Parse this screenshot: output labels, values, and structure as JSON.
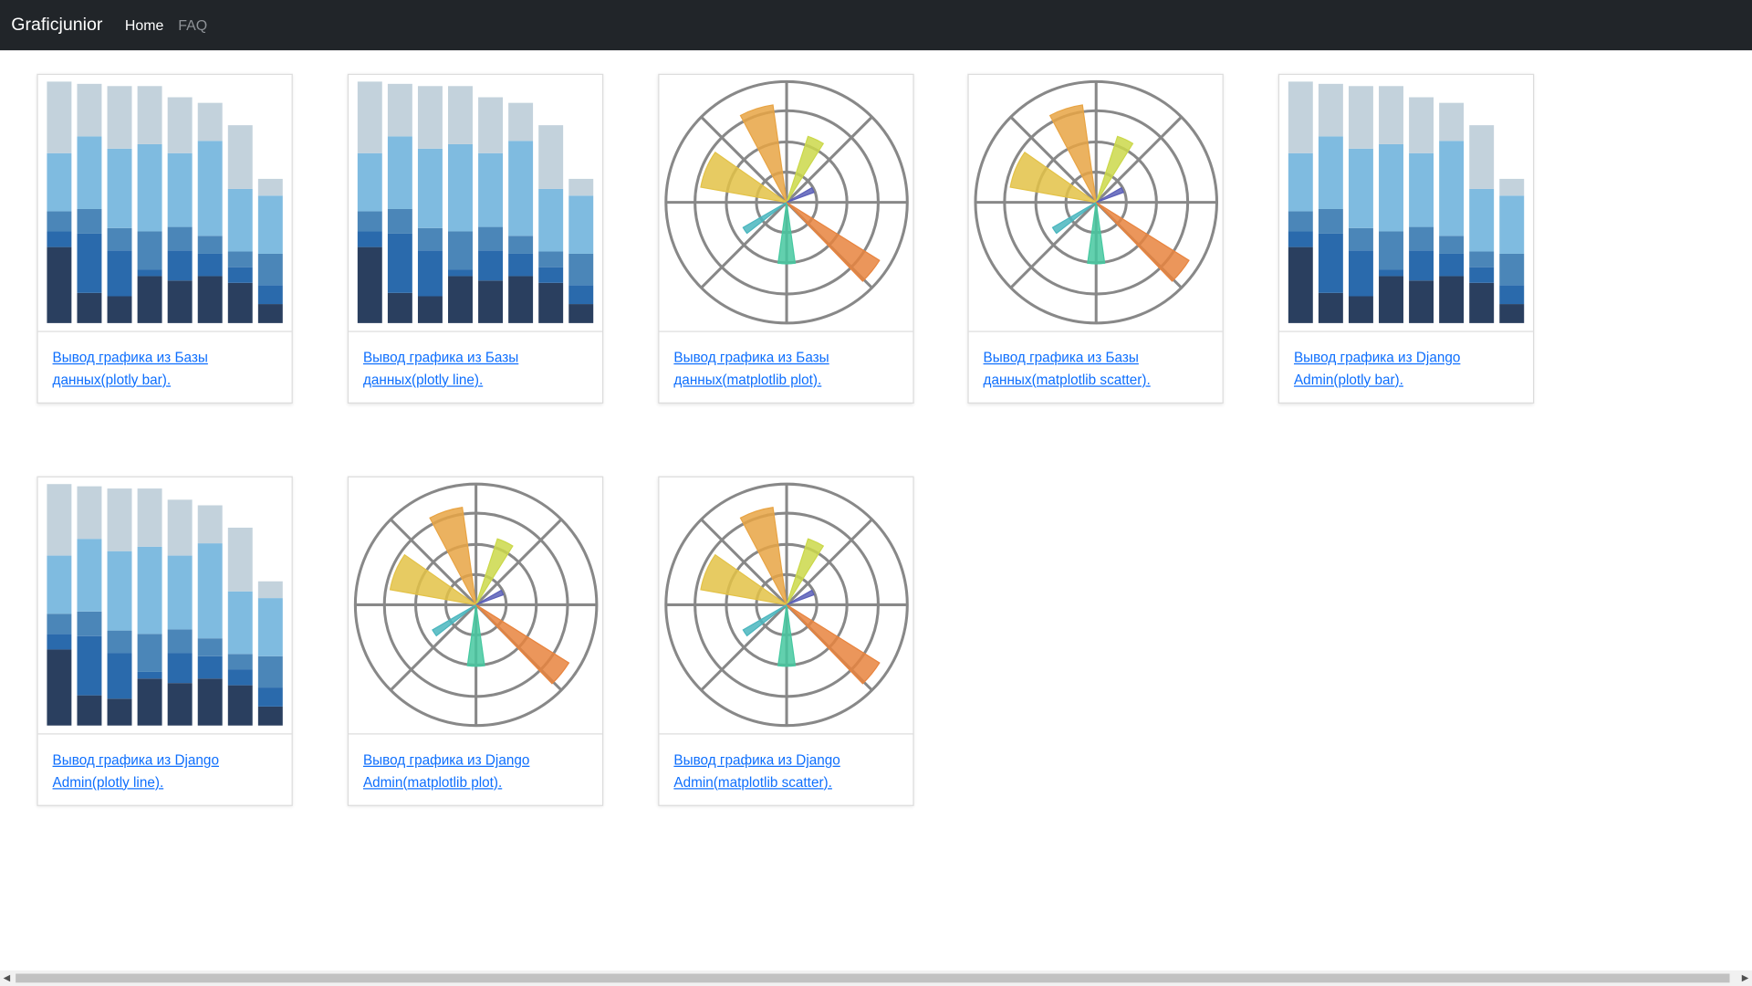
{
  "navbar": {
    "brand": "Graficjunior",
    "links": [
      {
        "label": "Home",
        "active": true
      },
      {
        "label": "FAQ",
        "active": false
      }
    ]
  },
  "cards": [
    {
      "thumb": "stacked-bar",
      "label": "Вывод графика из Базы данных(plotly bar)."
    },
    {
      "thumb": "stacked-bar",
      "label": "Вывод графика из Базы данных(plotly line)."
    },
    {
      "thumb": "polar-bar",
      "label": "Вывод графика из Базы данных(matplotlib plot)."
    },
    {
      "thumb": "polar-bar",
      "label": "Вывод графика из Базы данных(matplotlib scatter)."
    },
    {
      "thumb": "stacked-bar",
      "label": "Вывод графика из Django Admin(plotly bar)."
    },
    {
      "thumb": "stacked-bar",
      "label": "Вывод графика из Django Admin(plotly line)."
    },
    {
      "thumb": "polar-bar",
      "label": "Вывод графика из Django Admin(matplotlib plot)."
    },
    {
      "thumb": "polar-bar",
      "label": "Вывод графика из Django Admin(matplotlib scatter)."
    }
  ],
  "scrollbar": {
    "left_arrow": "◀",
    "right_arrow": "▶"
  },
  "colors": {
    "navbar_bg": "#212529",
    "link": "#0d6efd",
    "bar_segments": [
      "#2a3f5f",
      "#2a6aac",
      "#4b86b8",
      "#7fbbe0",
      "#c3d2dc"
    ],
    "polar_wedges": [
      "#e8a444",
      "#cbd84a",
      "#e3c247",
      "#5b5fb8",
      "#46c8a0",
      "#4ab6be",
      "#e8843e"
    ]
  }
}
